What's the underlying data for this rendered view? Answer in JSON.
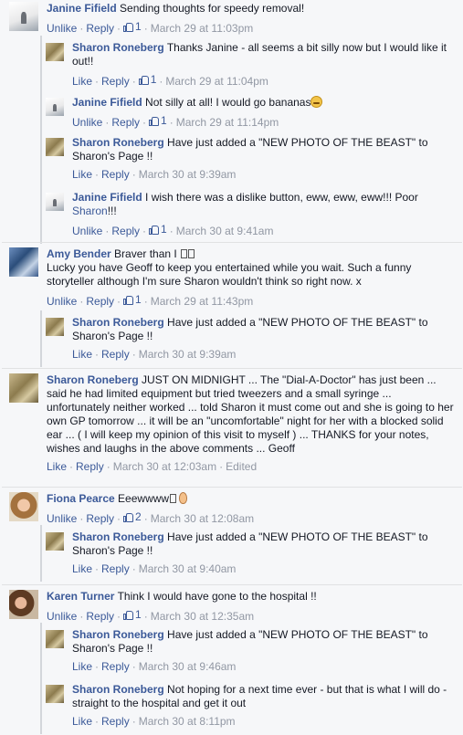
{
  "comments": [
    {
      "name": "Janine Fifield",
      "text": "Sending thoughts for speedy removal!",
      "actions": [
        "Unlike",
        "Reply"
      ],
      "likes": "1",
      "time": "March 29 at 11:03pm"
    },
    {
      "name": "Sharon Roneberg",
      "text": "Thanks Janine - all seems a bit silly now but I would like it out!!",
      "actions": [
        "Like",
        "Reply"
      ],
      "likes": "1",
      "time": "March 29 at 11:04pm"
    },
    {
      "name": "Janine Fifield",
      "text": "Not silly at all! I would go bananas",
      "actions": [
        "Unlike",
        "Reply"
      ],
      "likes": "1",
      "time": "March 29 at 11:14pm"
    },
    {
      "name": "Sharon Roneberg",
      "text": "Have just added a \"NEW PHOTO OF THE BEAST\" to Sharon's Page !!",
      "actions": [
        "Like",
        "Reply"
      ],
      "time": "March 30 at 9:39am"
    },
    {
      "name": "Janine Fifield",
      "text": "I wish there was a dislike button, eww, eww, eww!!! Poor",
      "link": "Sharon",
      "text_after": "!!!",
      "actions": [
        "Unlike",
        "Reply"
      ],
      "likes": "1",
      "time": "March 30 at 9:41am"
    },
    {
      "name": "Amy Bender",
      "text": "Braver than I",
      "text2": "Lucky you have Geoff to keep you entertained while you wait. Such a funny storyteller although I'm sure Sharon wouldn't think so right now. x",
      "actions": [
        "Unlike",
        "Reply"
      ],
      "likes": "1",
      "time": "March 29 at 11:43pm"
    },
    {
      "name": "Sharon Roneberg",
      "text": "Have just added a \"NEW PHOTO OF THE BEAST\" to Sharon's Page !!",
      "actions": [
        "Like",
        "Reply"
      ],
      "time": "March 30 at 9:39am"
    },
    {
      "name": "Sharon Roneberg",
      "text": "JUST ON MIDNIGHT ... The \"Dial-A-Doctor\" has just been ... said he had limited equipment but tried tweezers and a small syringe ... unfortunately neither worked ... told Sharon it must come out and she is going to her own GP tomorrow ... it will be an \"uncomfortable\" night for her with a blocked solid ear ... ( I will keep my opinion of this visit to myself ) ... THANKS for your notes, wishes and laughs in the above comments ... Geoff",
      "actions": [
        "Like",
        "Reply"
      ],
      "time": "March 30 at 12:03am",
      "edited": "Edited"
    },
    {
      "name": "Fiona Pearce",
      "text": "Eeewwww",
      "actions": [
        "Unlike",
        "Reply"
      ],
      "likes": "2",
      "time": "March 30 at 12:08am"
    },
    {
      "name": "Sharon Roneberg",
      "text": "Have just added a \"NEW PHOTO OF THE BEAST\" to Sharon's Page !!",
      "actions": [
        "Like",
        "Reply"
      ],
      "time": "March 30 at 9:40am"
    },
    {
      "name": "Karen Turner",
      "text": "Think I would have gone to the hospital !!",
      "actions": [
        "Unlike",
        "Reply"
      ],
      "likes": "1",
      "time": "March 30 at 12:35am"
    },
    {
      "name": "Sharon Roneberg",
      "text": "Have just added a \"NEW PHOTO OF THE BEAST\" to Sharon's Page !!",
      "actions": [
        "Like",
        "Reply"
      ],
      "time": "March 30 at 9:46am"
    },
    {
      "name": "Sharon Roneberg",
      "text": "Not hoping for a next time ever - but that is what I will do - straight to the hospital and get it out",
      "actions": [
        "Like",
        "Reply"
      ],
      "time": "March 30 at 8:11pm"
    }
  ],
  "colors": {
    "link": "#3b5998",
    "meta": "#9197a3",
    "background": "#f6f7f9"
  }
}
